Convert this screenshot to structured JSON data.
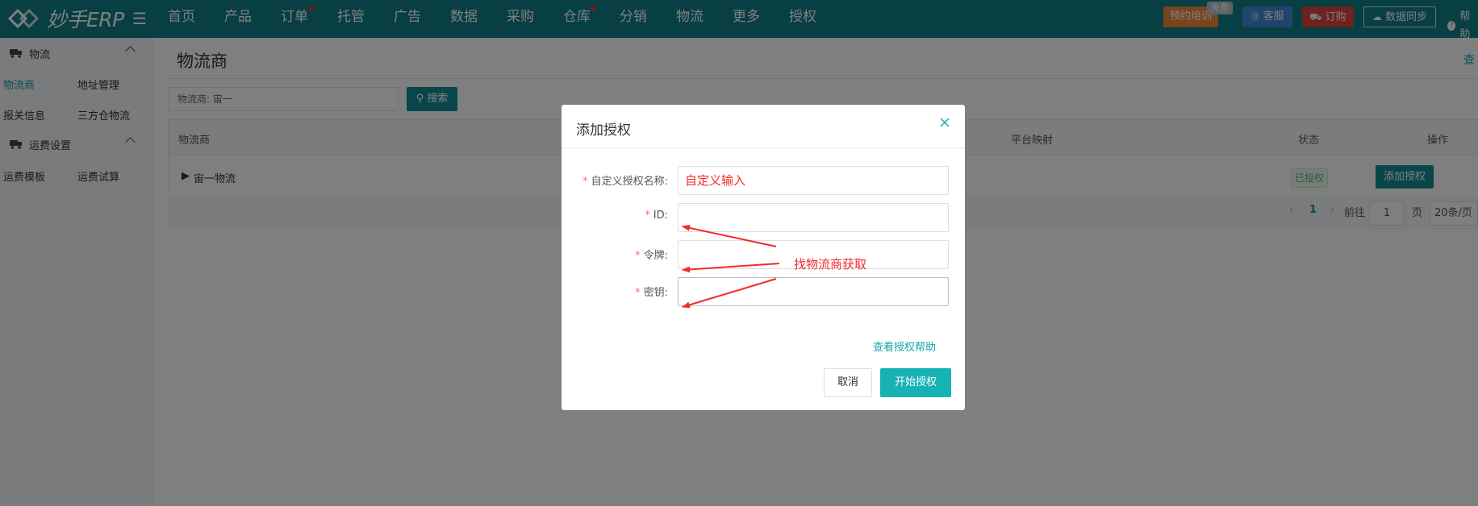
{
  "brand": {
    "name": "妙手ERP"
  },
  "nav": [
    {
      "label": "首页",
      "dot": false
    },
    {
      "label": "产品",
      "dot": false
    },
    {
      "label": "订单",
      "dot": true
    },
    {
      "label": "托管",
      "dot": false
    },
    {
      "label": "广告",
      "dot": false
    },
    {
      "label": "数据",
      "dot": false
    },
    {
      "label": "采购",
      "dot": false
    },
    {
      "label": "仓库",
      "dot": true
    },
    {
      "label": "分销",
      "dot": false
    },
    {
      "label": "物流",
      "dot": false
    },
    {
      "label": "更多",
      "dot": false
    },
    {
      "label": "授权",
      "dot": false
    }
  ],
  "topbar": {
    "training": "预约培训",
    "free_badge": "免费",
    "service": "客服",
    "order": "订购",
    "sync": "数据同步",
    "help": "帮助"
  },
  "sidebar": {
    "group1": "物流",
    "group1_items": [
      "物流商",
      "地址管理",
      "报关信息",
      "三方仓物流"
    ],
    "group2": "运费设置",
    "group2_items": [
      "运费模板",
      "运费试算"
    ]
  },
  "page": {
    "title": "物流商",
    "top_right": "查",
    "filter_text": "物流商:   宙一",
    "search_label": "搜索"
  },
  "table": {
    "headers": {
      "provider": "物流商",
      "platform_map": "平台映射",
      "status": "状态",
      "action": "操作"
    },
    "rows": [
      {
        "provider": "宙一物流",
        "status": "已授权",
        "action": "添加授权"
      }
    ]
  },
  "pagination": {
    "current_page": "1",
    "goto_label": "前往",
    "goto_value": "1",
    "page_unit": "页",
    "page_size": "20条/页"
  },
  "modal": {
    "title": "添加授权",
    "fields": [
      {
        "label": "自定义授权名称:",
        "value": "自定义输入"
      },
      {
        "label": "ID:",
        "value": ""
      },
      {
        "label": "令牌:",
        "value": ""
      },
      {
        "label": "密钥:",
        "value": ""
      }
    ],
    "help_link": "查看授权帮助",
    "cancel_label": "取消",
    "start_label": "开始授权"
  },
  "annotation": {
    "text": "找物流商获取"
  },
  "colors": {
    "topbar": "#0f7f86",
    "accent": "#17b2b4",
    "annotation_red": "#f52a2a"
  }
}
